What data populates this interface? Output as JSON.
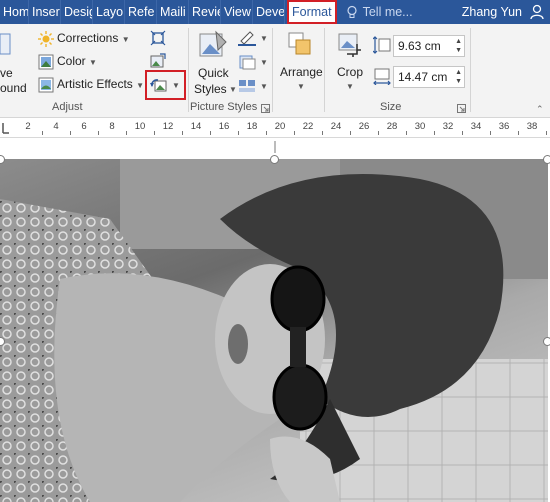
{
  "tabs": [
    {
      "label": "Hom"
    },
    {
      "label": "Inser"
    },
    {
      "label": "Desig"
    },
    {
      "label": "Layo"
    },
    {
      "label": "Refe"
    },
    {
      "label": "Maili"
    },
    {
      "label": "Revie"
    },
    {
      "label": "View"
    },
    {
      "label": "Deve"
    }
  ],
  "active_tab": "Format",
  "tell_me": "Tell me...",
  "user_name": "Zhang Yun",
  "adjust": {
    "remove_bg_partial_1": "ve",
    "remove_bg_partial_2": "ound",
    "corrections": "Corrections",
    "color": "Color",
    "artistic_effects": "Artistic Effects",
    "group_label": "Adjust"
  },
  "picture_styles": {
    "quick_styles_1": "Quick",
    "quick_styles_2": "Styles",
    "group_label": "Picture Styles"
  },
  "arrange": {
    "label": "Arrange"
  },
  "crop": {
    "label": "Crop"
  },
  "size": {
    "height_value": "9.63 cm",
    "width_value": "14.47 cm",
    "group_label": "Size"
  },
  "ruler_labels": [
    "2",
    "4",
    "6",
    "8",
    "10",
    "12",
    "14",
    "16",
    "18",
    "20",
    "22",
    "24",
    "26",
    "28",
    "30",
    "32",
    "34",
    "36",
    "38"
  ],
  "colors": {
    "tab_bar": "#2b579a",
    "highlight": "#d21f26",
    "ribbon": "#f3f3f3"
  }
}
